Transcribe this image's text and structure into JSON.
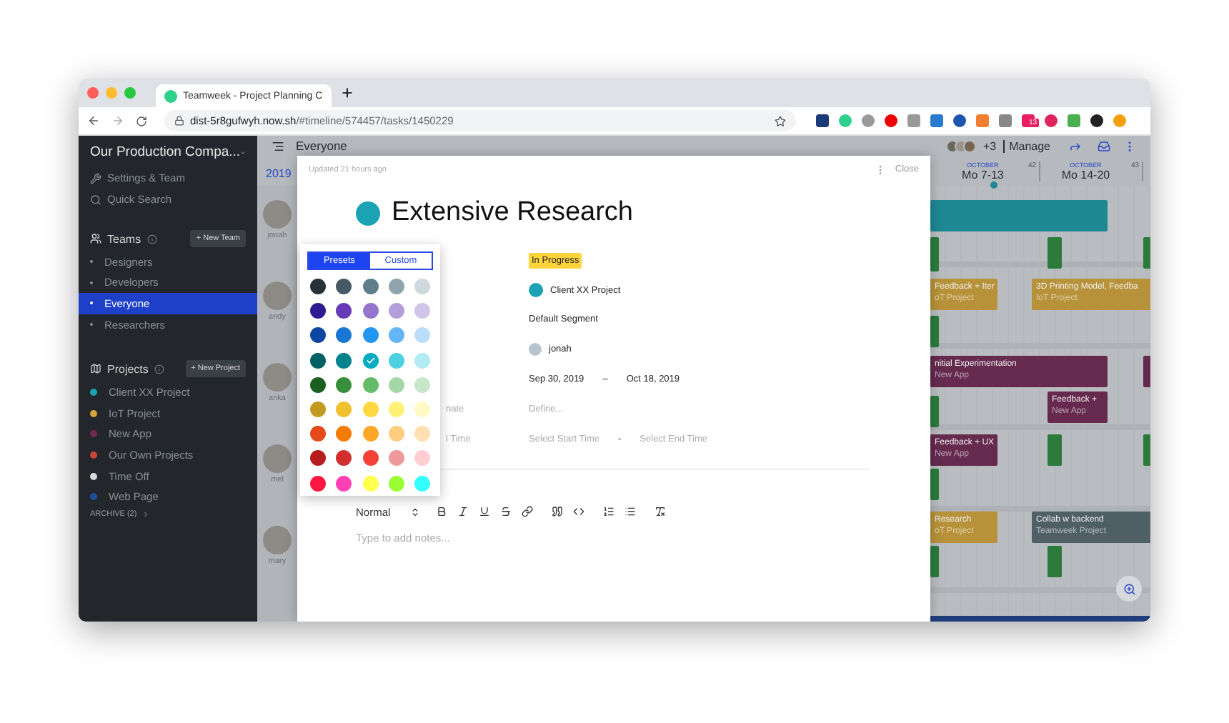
{
  "browser": {
    "tab_title": "Teamweek - Project Planning C",
    "url_host": "dist-5r8gufwyh.now.sh",
    "url_path": "/#timeline/574457/tasks/1450229",
    "extension_badge": "13"
  },
  "sidebar": {
    "company": "Our Production Compa...",
    "links": [
      "Settings & Team",
      "Quick Search"
    ],
    "teams": {
      "title": "Teams",
      "button": "+ New Team",
      "items": [
        {
          "label": "Designers",
          "selected": false
        },
        {
          "label": "Developers",
          "selected": false
        },
        {
          "label": "Everyone",
          "selected": true
        },
        {
          "label": "Researchers",
          "selected": false
        }
      ]
    },
    "projects": {
      "title": "Projects",
      "button": "+ New Project",
      "items": [
        {
          "label": "Client XX Project",
          "color": "#1ba3b4"
        },
        {
          "label": "IoT Project",
          "color": "#d5a43a"
        },
        {
          "label": "New App",
          "color": "#6e2a52"
        },
        {
          "label": "Our Own Projects",
          "color": "#c9453b"
        },
        {
          "label": "Time Off",
          "color": "#d9d9d9"
        },
        {
          "label": "Web Page",
          "color": "#1f4e9c"
        }
      ]
    },
    "archive": "ARCHIVE (2)"
  },
  "header": {
    "title": "Everyone",
    "year": "2019",
    "extra_members": "+3",
    "manage": "Manage",
    "weeks": [
      {
        "month": "OCTOBER",
        "range": "Mo 7-13",
        "number": "42"
      },
      {
        "month": "OCTOBER",
        "range": "Mo 14-20",
        "number": "43"
      }
    ]
  },
  "people": [
    {
      "name": "jonah"
    },
    {
      "name": "andy"
    },
    {
      "name": "anka"
    },
    {
      "name": "mel"
    },
    {
      "name": "mary"
    }
  ],
  "lanes": [
    [
      {
        "kind": "task",
        "color": "#1e8893"
      },
      {
        "kind": "marker",
        "color": "#2c7a3c"
      },
      {
        "kind": "marker",
        "color": "#2c7a3c"
      },
      {
        "kind": "marker",
        "color": "#2c7a3c"
      }
    ],
    [
      {
        "kind": "task",
        "title": "Feedback + Iter",
        "project": "oT Project",
        "color": "#b8923a"
      },
      {
        "kind": "task",
        "title": "3D Printing Model, Feedba",
        "project": "IoT Project",
        "color": "#b8923a"
      },
      {
        "kind": "marker",
        "color": "#2c7a3c"
      }
    ],
    [
      {
        "kind": "task",
        "title": "nitial Experimentation",
        "project": "New App",
        "color": "#652a4e"
      },
      {
        "kind": "task",
        "title": "Feedback +",
        "project": "New App",
        "color": "#652a4e"
      },
      {
        "kind": "marker",
        "color": "#2c7a3c"
      },
      {
        "kind": "marker",
        "color": "#652a4e"
      }
    ],
    [
      {
        "kind": "task",
        "title": "Feedback + UX",
        "project": "New App",
        "color": "#652a4e"
      },
      {
        "kind": "marker",
        "color": "#2c7a3c"
      },
      {
        "kind": "marker",
        "color": "#2c7a3c"
      },
      {
        "kind": "marker",
        "color": "#2c7a3c"
      }
    ],
    [
      {
        "kind": "task",
        "title": "Research",
        "project": "oT Project",
        "color": "#b8923a"
      },
      {
        "kind": "task",
        "title": "Collab w backend",
        "project": "Teamweek Project",
        "color": "#4f5f66"
      },
      {
        "kind": "marker",
        "color": "#2c7a3c"
      },
      {
        "kind": "marker",
        "color": "#2c7a3c"
      }
    ]
  ],
  "task": {
    "updated": "Updated 21 hours ago",
    "close": "Close",
    "title": "Extensive Research",
    "color": "#1ba3b4",
    "fields": [
      {
        "kind": "status",
        "value": "In Progress"
      },
      {
        "kind": "project",
        "value": "Client XX Project",
        "color": "#1ba3b4"
      },
      {
        "kind": "text",
        "value": "Default Segment"
      },
      {
        "kind": "assignee",
        "value": "jonah"
      },
      {
        "kind": "range",
        "start": "Sep 30, 2019",
        "separator": "–",
        "end": "Oct 18, 2019"
      },
      {
        "kind": "hint",
        "label": "nate",
        "placeholder": "Define..."
      },
      {
        "kind": "hint_range",
        "label": "l Time",
        "start_placeholder": "Select Start Time",
        "separator": "-",
        "end_placeholder": "Select End Time"
      }
    ],
    "toolbar": {
      "style": "Normal"
    },
    "notes": {
      "placeholder": "Type to add notes..."
    }
  },
  "picker": {
    "tabs": [
      {
        "label": "Presets",
        "selected": true
      },
      {
        "label": "Custom",
        "selected": false
      }
    ],
    "swatches": [
      {
        "color": "#263238",
        "selected": false
      },
      {
        "color": "#455a64",
        "selected": false
      },
      {
        "color": "#607d8b",
        "selected": false
      },
      {
        "color": "#90a4ae",
        "selected": false
      },
      {
        "color": "#cfd8dc",
        "selected": false
      },
      {
        "color": "#311b92",
        "selected": false
      },
      {
        "color": "#673ab7",
        "selected": false
      },
      {
        "color": "#9575cd",
        "selected": false
      },
      {
        "color": "#b39ddb",
        "selected": false
      },
      {
        "color": "#d1c4e9",
        "selected": false
      },
      {
        "color": "#0d47a1",
        "selected": false
      },
      {
        "color": "#1976d2",
        "selected": false
      },
      {
        "color": "#2196f3",
        "selected": false
      },
      {
        "color": "#64b5f6",
        "selected": false
      },
      {
        "color": "#bbdefb",
        "selected": false
      },
      {
        "color": "#006064",
        "selected": false
      },
      {
        "color": "#00838f",
        "selected": false
      },
      {
        "color": "#00acc1",
        "selected": true
      },
      {
        "color": "#4dd0e1",
        "selected": false
      },
      {
        "color": "#b2ebf2",
        "selected": false
      },
      {
        "color": "#1b5e20",
        "selected": false
      },
      {
        "color": "#388e3c",
        "selected": false
      },
      {
        "color": "#66bb6a",
        "selected": false
      },
      {
        "color": "#a5d6a7",
        "selected": false
      },
      {
        "color": "#c8e6c9",
        "selected": false
      },
      {
        "color": "#c29a1f",
        "selected": false
      },
      {
        "color": "#f0c02f",
        "selected": false
      },
      {
        "color": "#ffd740",
        "selected": false
      },
      {
        "color": "#fff176",
        "selected": false
      },
      {
        "color": "#fff9c4",
        "selected": false
      },
      {
        "color": "#e64a19",
        "selected": false
      },
      {
        "color": "#f57c00",
        "selected": false
      },
      {
        "color": "#ffa726",
        "selected": false
      },
      {
        "color": "#ffcc80",
        "selected": false
      },
      {
        "color": "#ffe0b2",
        "selected": false
      },
      {
        "color": "#b71c1c",
        "selected": false
      },
      {
        "color": "#d32f2f",
        "selected": false
      },
      {
        "color": "#f44336",
        "selected": false
      },
      {
        "color": "#ef9a9a",
        "selected": false
      },
      {
        "color": "#ffcdd2",
        "selected": false
      },
      {
        "color": "#ff1744",
        "selected": false
      },
      {
        "color": "#ff40b5",
        "selected": false
      },
      {
        "color": "#ffff4d",
        "selected": false
      },
      {
        "color": "#99ff33",
        "selected": false
      },
      {
        "color": "#33ffff",
        "selected": false
      }
    ]
  }
}
